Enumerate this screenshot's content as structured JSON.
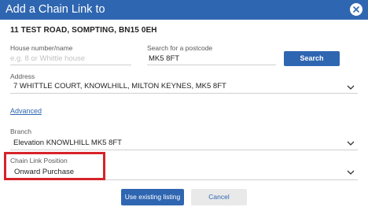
{
  "dialog": {
    "title": "Add a Chain Link to",
    "close_icon": "close-icon"
  },
  "property": {
    "address": "11 TEST ROAD, SOMPTING, BN15 0EH"
  },
  "form": {
    "house_label": "House number/name",
    "house_placeholder": "e.g. 8 or Whittle house",
    "house_value": "",
    "postcode_label": "Search for a postcode",
    "postcode_value": "MK5 8FT",
    "search_label": "Search",
    "address_label": "Address",
    "address_value": "7 WHITTLE COURT, KNOWLHILL, MILTON KEYNES, MK5 8FT",
    "advanced_label": "Advanced",
    "branch_label": "Branch",
    "branch_value": "Elevation KNOWLHILL MK5 8FT",
    "position_label": "Chain Link Position",
    "position_value": "Onward Purchase"
  },
  "actions": {
    "primary_label": "Use existing listing",
    "cancel_label": "Cancel"
  },
  "colors": {
    "accent": "#2f66b1",
    "highlight": "#d6232a"
  }
}
